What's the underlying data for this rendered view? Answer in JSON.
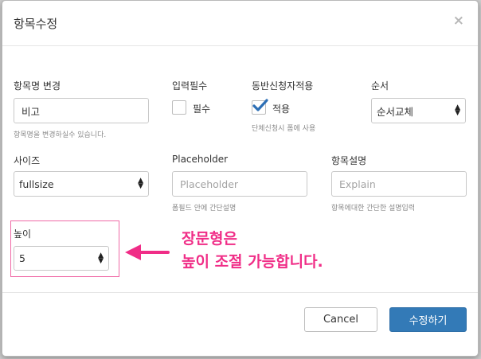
{
  "modal": {
    "title": "항목수정",
    "close": "×"
  },
  "fields": {
    "item_name": {
      "label": "항목명 변경",
      "value": "비고",
      "help": "항목명을 변경하실수 있습니다."
    },
    "required": {
      "label": "입력필수",
      "checkbox_label": "필수",
      "checked": false
    },
    "sync": {
      "label": "동반신청자적용",
      "checkbox_label": "적용",
      "checked": true,
      "help": "단체신청시 폼에 사용"
    },
    "order": {
      "label": "순서",
      "selected": "순서교체"
    },
    "size": {
      "label": "사이즈",
      "selected": "fullsize"
    },
    "placeholder": {
      "label": "Placeholder",
      "placeholder": "Placeholder",
      "help": "폼필드 안에 간단설명"
    },
    "description": {
      "label": "항목설명",
      "placeholder": "Explain",
      "help": "항목에대한 간단한 설명입력"
    },
    "height": {
      "label": "높이",
      "selected": "5"
    }
  },
  "annotation": {
    "line1": "장문형은",
    "line2": "높이 조절 가능합니다.",
    "color": "#f02d87"
  },
  "footer": {
    "cancel_label": "Cancel",
    "save_label": "수정하기"
  },
  "colors": {
    "primary": "#337ab7",
    "highlight_border": "#f06aa6",
    "check": "#2d6fb5"
  }
}
